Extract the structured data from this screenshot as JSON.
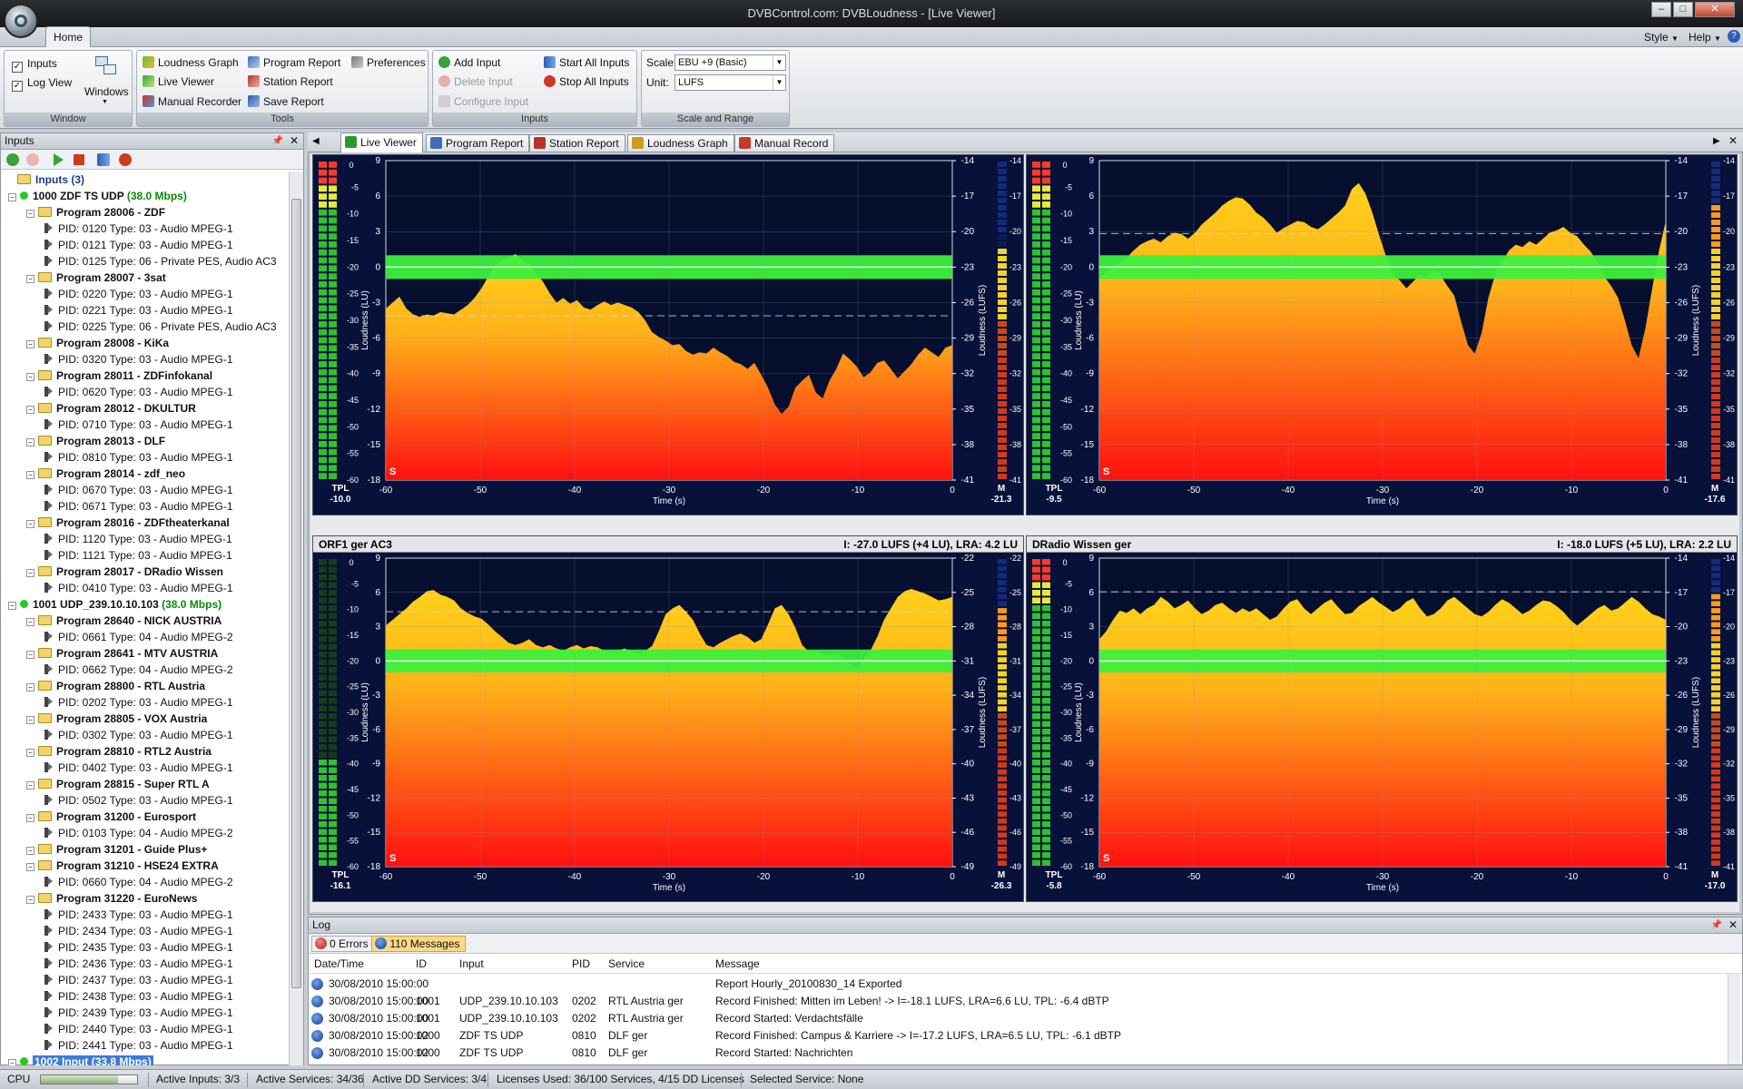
{
  "window": {
    "title": "DVBControl.com: DVBLoudness - [Live Viewer]",
    "buttons": [
      "–",
      "□",
      "✕"
    ]
  },
  "ribbon": {
    "tab": "Home",
    "right": [
      "Style",
      "Help"
    ],
    "window_group": {
      "label": "Window",
      "inputs": "Inputs",
      "log_view": "Log View",
      "windows": "Windows"
    },
    "tools_group": {
      "label": "Tools",
      "loudness_graph": "Loudness Graph",
      "live_viewer": "Live Viewer",
      "manual_recorder": "Manual Recorder",
      "program_report": "Program Report",
      "station_report": "Station Report",
      "save_report": "Save Report",
      "preferences": "Preferences"
    },
    "inputs_group": {
      "label": "Inputs",
      "add_input": "Add Input",
      "delete_input": "Delete Input",
      "configure_input": "Configure Input",
      "start_all": "Start All Inputs",
      "stop_all": "Stop All Inputs"
    },
    "scale_group": {
      "label": "Scale and Range",
      "scale_label": "Scale:",
      "scale_value": "EBU +9 (Basic)",
      "unit_label": "Unit:",
      "unit_value": "LUFS"
    }
  },
  "inputs_panel": {
    "title": "Inputs",
    "tree": [
      {
        "level": 0,
        "kind": "root",
        "text": "Inputs",
        "extra": " (3)"
      },
      {
        "level": 1,
        "kind": "input",
        "text": "1000 ZDF TS UDP",
        "extra": " (38.0 Mbps)"
      },
      {
        "level": 2,
        "kind": "program",
        "text": "Program 28006 - ZDF"
      },
      {
        "level": 3,
        "kind": "pid",
        "text": "PID: 0120  Type: 03 - Audio MPEG-1"
      },
      {
        "level": 3,
        "kind": "pid",
        "text": "PID: 0121  Type: 03 - Audio MPEG-1"
      },
      {
        "level": 3,
        "kind": "pid",
        "text": "PID: 0125  Type: 06 - Private PES, Audio AC3"
      },
      {
        "level": 2,
        "kind": "program",
        "text": "Program 28007 - 3sat"
      },
      {
        "level": 3,
        "kind": "pid",
        "text": "PID: 0220  Type: 03 - Audio MPEG-1"
      },
      {
        "level": 3,
        "kind": "pid",
        "text": "PID: 0221  Type: 03 - Audio MPEG-1"
      },
      {
        "level": 3,
        "kind": "pid",
        "text": "PID: 0225  Type: 06 - Private PES, Audio AC3"
      },
      {
        "level": 2,
        "kind": "program",
        "text": "Program 28008 - KiKa"
      },
      {
        "level": 3,
        "kind": "pid",
        "text": "PID: 0320  Type: 03 - Audio MPEG-1"
      },
      {
        "level": 2,
        "kind": "program",
        "text": "Program 28011 - ZDFinfokanal"
      },
      {
        "level": 3,
        "kind": "pid",
        "text": "PID: 0620  Type: 03 - Audio MPEG-1"
      },
      {
        "level": 2,
        "kind": "program",
        "text": "Program 28012 - DKULTUR"
      },
      {
        "level": 3,
        "kind": "pid",
        "text": "PID: 0710  Type: 03 - Audio MPEG-1"
      },
      {
        "level": 2,
        "kind": "program",
        "text": "Program 28013 - DLF"
      },
      {
        "level": 3,
        "kind": "pid",
        "text": "PID: 0810  Type: 03 - Audio MPEG-1"
      },
      {
        "level": 2,
        "kind": "program",
        "text": "Program 28014 - zdf_neo"
      },
      {
        "level": 3,
        "kind": "pid",
        "text": "PID: 0670  Type: 03 - Audio MPEG-1"
      },
      {
        "level": 3,
        "kind": "pid",
        "text": "PID: 0671  Type: 03 - Audio MPEG-1"
      },
      {
        "level": 2,
        "kind": "program",
        "text": "Program 28016 - ZDFtheaterkanal"
      },
      {
        "level": 3,
        "kind": "pid",
        "text": "PID: 1120  Type: 03 - Audio MPEG-1"
      },
      {
        "level": 3,
        "kind": "pid",
        "text": "PID: 1121  Type: 03 - Audio MPEG-1"
      },
      {
        "level": 2,
        "kind": "program",
        "text": "Program 28017 - DRadio Wissen"
      },
      {
        "level": 3,
        "kind": "pid",
        "text": "PID: 0410  Type: 03 - Audio MPEG-1"
      },
      {
        "level": 1,
        "kind": "input",
        "text": "1001 UDP_239.10.10.103",
        "extra": " (38.0 Mbps)"
      },
      {
        "level": 2,
        "kind": "program",
        "text": "Program 28640 - NICK AUSTRIA"
      },
      {
        "level": 3,
        "kind": "pid",
        "text": "PID: 0661  Type: 04 - Audio MPEG-2"
      },
      {
        "level": 2,
        "kind": "program",
        "text": "Program 28641 - MTV AUSTRIA"
      },
      {
        "level": 3,
        "kind": "pid",
        "text": "PID: 0662  Type: 04 - Audio MPEG-2"
      },
      {
        "level": 2,
        "kind": "program",
        "text": "Program 28800 - RTL Austria"
      },
      {
        "level": 3,
        "kind": "pid",
        "text": "PID: 0202  Type: 03 - Audio MPEG-1"
      },
      {
        "level": 2,
        "kind": "program",
        "text": "Program 28805 - VOX Austria"
      },
      {
        "level": 3,
        "kind": "pid",
        "text": "PID: 0302  Type: 03 - Audio MPEG-1"
      },
      {
        "level": 2,
        "kind": "program",
        "text": "Program 28810 - RTL2 Austria"
      },
      {
        "level": 3,
        "kind": "pid",
        "text": "PID: 0402  Type: 03 - Audio MPEG-1"
      },
      {
        "level": 2,
        "kind": "program",
        "text": "Program 28815 - Super RTL A"
      },
      {
        "level": 3,
        "kind": "pid",
        "text": "PID: 0502  Type: 03 - Audio MPEG-1"
      },
      {
        "level": 2,
        "kind": "program",
        "text": "Program 31200 - Eurosport"
      },
      {
        "level": 3,
        "kind": "pid",
        "text": "PID: 0103  Type: 04 - Audio MPEG-2"
      },
      {
        "level": 2,
        "kind": "program",
        "text": "Program 31201 - Guide Plus+"
      },
      {
        "level": 2,
        "kind": "program",
        "text": "Program 31210 - HSE24 EXTRA"
      },
      {
        "level": 3,
        "kind": "pid",
        "text": "PID: 0660  Type: 04 - Audio MPEG-2"
      },
      {
        "level": 2,
        "kind": "program",
        "text": "Program 31220 - EuroNews"
      },
      {
        "level": 3,
        "kind": "pid",
        "text": "PID: 2433  Type: 03 - Audio MPEG-1"
      },
      {
        "level": 3,
        "kind": "pid",
        "text": "PID: 2434  Type: 03 - Audio MPEG-1"
      },
      {
        "level": 3,
        "kind": "pid",
        "text": "PID: 2435  Type: 03 - Audio MPEG-1"
      },
      {
        "level": 3,
        "kind": "pid",
        "text": "PID: 2436  Type: 03 - Audio MPEG-1"
      },
      {
        "level": 3,
        "kind": "pid",
        "text": "PID: 2437  Type: 03 - Audio MPEG-1"
      },
      {
        "level": 3,
        "kind": "pid",
        "text": "PID: 2438  Type: 03 - Audio MPEG-1"
      },
      {
        "level": 3,
        "kind": "pid",
        "text": "PID: 2439  Type: 03 - Audio MPEG-1"
      },
      {
        "level": 3,
        "kind": "pid",
        "text": "PID: 2440  Type: 03 - Audio MPEG-1"
      },
      {
        "level": 3,
        "kind": "pid",
        "text": "PID: 2441  Type: 03 - Audio MPEG-1"
      },
      {
        "level": 1,
        "kind": "input_selected",
        "text": "1002 Input",
        "extra": " (33.8 Mbps)"
      }
    ]
  },
  "doc_tabs": [
    {
      "label": "Live Viewer",
      "active": true
    },
    {
      "label": "Program Report"
    },
    {
      "label": "Station Report"
    },
    {
      "label": "Loudness Graph"
    },
    {
      "label": "Manual Record"
    }
  ],
  "meters": [
    {
      "title": "",
      "stats": "",
      "tpl": "-10.0",
      "m": "-21.3",
      "right_ticks": [
        "-14",
        "-17",
        "-20",
        "-23",
        "-26",
        "-29",
        "-32",
        "-35",
        "-38",
        "-41"
      ],
      "history": [
        -3.5,
        -3,
        -2.5,
        -3.5,
        -4,
        -4.2,
        -4,
        -4.1,
        -3.8,
        -3.9,
        -4,
        -3.6,
        -3.2,
        -2.6,
        -1.8,
        -0.8,
        0.2,
        0.6,
        0.8,
        1.1,
        0.6,
        0.3,
        -0.5,
        -1.2,
        -2.2,
        -3,
        -2.6,
        -3.1,
        -2.8,
        -3.4,
        -3.6,
        -3.2,
        -2.9,
        -3.2,
        -3,
        -3.2,
        -3.4,
        -3.8,
        -4.5,
        -5.5,
        -5.9,
        -6.2,
        -6.6,
        -6.5,
        -7.1,
        -7.4,
        -7.2,
        -7.3,
        -6.8,
        -7.2,
        -7.5,
        -8,
        -8.2,
        -8.6,
        -8.1,
        -9.1,
        -10.2,
        -11.6,
        -12.4,
        -11.8,
        -10.2,
        -9.6,
        -9.1,
        -10.6,
        -11.1,
        -9.6,
        -8.6,
        -7.3,
        -7.8,
        -8.4,
        -9.3,
        -8.9,
        -8.1,
        -7.9,
        -8.6,
        -9.4,
        -8.8,
        -8.2,
        -7.4,
        -6.8,
        -7.2,
        -7.6,
        -6.8,
        -6.6
      ]
    },
    {
      "title": "",
      "stats": "",
      "tpl": "-9.5",
      "m": "-17.6",
      "right_ticks": [
        "-14",
        "-17",
        "-20",
        "-23",
        "-26",
        "-29",
        "-32",
        "-35",
        "-38",
        "-41"
      ],
      "history": [
        -0.8,
        -0.5,
        0.1,
        0.3,
        0.8,
        1.4,
        1.9,
        2.2,
        2.4,
        2.1,
        2.6,
        2.9,
        2.8,
        2.4,
        2.9,
        3.6,
        4.1,
        4.6,
        5.2,
        5.6,
        5.9,
        5.8,
        5.3,
        4.6,
        4.2,
        3.6,
        2.9,
        3.3,
        3.6,
        3.9,
        3.8,
        3.4,
        3.2,
        3.6,
        4.1,
        4.6,
        5.2,
        6.6,
        7.1,
        6.2,
        4.6,
        2.7,
        0.9,
        -0.6,
        -1.1,
        -1.8,
        -1.2,
        -0.6,
        -0.8,
        -0.2,
        -0.7,
        -1.6,
        -2.4,
        -4.6,
        -6.6,
        -7.3,
        -5.6,
        -2.6,
        -0.6,
        0.4,
        1.4,
        1.9,
        1.7,
        2.2,
        1.9,
        2.4,
        2.9,
        3.1,
        3.4,
        2.9,
        2.6,
        1.9,
        1.3,
        0.4,
        -0.8,
        -1.6,
        -2.6,
        -4.5,
        -6.6,
        -7.7,
        -5.2,
        -1.8,
        1.4,
        3.9
      ]
    },
    {
      "title": "ORF1 ger AC3",
      "stats": "I: -27.0 LUFS (+4 LU),  LRA: 4.2 LU",
      "tpl": "-16.1",
      "m": "-26.3",
      "right_ticks": [
        "-22",
        "-25",
        "-28",
        "-31",
        "-34",
        "-37",
        "-40",
        "-43",
        "-46",
        "-49"
      ],
      "history": [
        3.1,
        3.6,
        4.1,
        4.6,
        5.2,
        5.6,
        6.1,
        6.2,
        5.8,
        5.6,
        5.3,
        4.6,
        4.2,
        3.9,
        3.7,
        3.2,
        2.6,
        2.1,
        1.6,
        1.4,
        1.6,
        1.9,
        1.4,
        1.2,
        1.4,
        1.1,
        0.9,
        1.2,
        1.4,
        1.1,
        1.3,
        1.2,
        0.9,
        0.7,
        0.9,
        1.1,
        0.8,
        0.6,
        0.9,
        1.3,
        2.6,
        4.1,
        4.6,
        4.9,
        4.3,
        3.6,
        2.4,
        1.4,
        1.2,
        1.6,
        1.9,
        2.2,
        2.4,
        2.1,
        1.6,
        1.9,
        3.2,
        4.6,
        4.9,
        4.1,
        2.9,
        1.4,
        0.8,
        0.9,
        0.6,
        0.4,
        0.6,
        0.2,
        -0.2,
        -0.6,
        0.1,
        0.9,
        2.1,
        3.6,
        4.6,
        5.6,
        6.1,
        6.3,
        6.1,
        5.9,
        5.6,
        5.3,
        5.4,
        5.6
      ]
    },
    {
      "title": "DRadio Wissen ger",
      "stats": "I: -18.0 LUFS (+5 LU),  LRA: 2.2 LU",
      "tpl": "-5.8",
      "m": "-17.0",
      "right_ticks": [
        "-14",
        "-17",
        "-20",
        "-23",
        "-26",
        "-29",
        "-32",
        "-35",
        "-38",
        "-41"
      ],
      "history": [
        1.9,
        2.6,
        3.6,
        4.4,
        4.2,
        4.6,
        4.1,
        4.6,
        4.9,
        5.6,
        5.2,
        4.6,
        4.9,
        5.3,
        4.6,
        4.1,
        4.4,
        4.9,
        5.1,
        4.6,
        4.2,
        4.6,
        4.3,
        4.6,
        4.1,
        3.6,
        3.9,
        4.6,
        5.2,
        5.4,
        4.6,
        4.1,
        4.6,
        5.1,
        5.4,
        4.7,
        4.1,
        4.2,
        4.8,
        5.2,
        5.6,
        5.1,
        4.7,
        4.3,
        4.6,
        5.2,
        5.5,
        4.6,
        3.9,
        4.1,
        4.6,
        5.3,
        5.6,
        5.1,
        4.6,
        4.1,
        3.9,
        4.3,
        4.9,
        5.4,
        5.1,
        4.6,
        4.1,
        4.4,
        4.9,
        5.3,
        5.2,
        4.8,
        4.3,
        3.6,
        3.1,
        3.6,
        4.1,
        4.6,
        4.9,
        4.4,
        4.6,
        5.1,
        5.6,
        5.2,
        4.6,
        4.1,
        3.9,
        3.6
      ]
    }
  ],
  "chart_axes": {
    "x_ticks": [
      "-60",
      "-50",
      "-40",
      "-30",
      "-20",
      "-10",
      "0"
    ],
    "xlabel": "Time (s)",
    "y_ticks": [
      "9",
      "6",
      "3",
      "0",
      "-3",
      "-6",
      "-9",
      "-12",
      "-15",
      "-18"
    ],
    "ylabel_left": "Loudness (LU)",
    "ylabel_right": "Loudness (LUFS)",
    "ylim": [
      -18,
      9
    ],
    "xlim": [
      -60,
      0
    ],
    "target_band": [
      -1,
      1
    ],
    "s_label": "S",
    "tpl_label": "TPL",
    "m_label": "M",
    "meter_ticks": [
      "0",
      "-5",
      "-10",
      "-15",
      "-20",
      "-25",
      "-30",
      "-35",
      "-40",
      "-45",
      "-50",
      "-55",
      "-60"
    ]
  },
  "log": {
    "title": "Log",
    "errors_tab": "0 Errors",
    "messages_tab": "110 Messages",
    "columns": [
      "Date/Time",
      "ID",
      "Input",
      "PID",
      "Service",
      "Message"
    ],
    "rows": [
      [
        "30/08/2010 15:00:00",
        "",
        "",
        "",
        "",
        "Report Hourly_20100830_14 Exported"
      ],
      [
        "30/08/2010 15:00:00",
        "1001",
        "UDP_239.10.10.103",
        "0202",
        "RTL Austria ger",
        "Record Finished: Mitten im Leben! -> I=-18.1 LUFS, LRA=6.6 LU, TPL: -6.4 dBTP"
      ],
      [
        "30/08/2010 15:00:00",
        "1001",
        "UDP_239.10.10.103",
        "0202",
        "RTL Austria ger",
        "Record Started: Verdachtsfälle"
      ],
      [
        "30/08/2010 15:00:02",
        "1000",
        "ZDF TS UDP",
        "0810",
        "DLF ger",
        "Record Finished: Campus & Karriere -> I=-17.2 LUFS, LRA=6.5 LU, TPL: -6.1 dBTP"
      ],
      [
        "30/08/2010 15:00:02",
        "1000",
        "ZDF TS UDP",
        "0810",
        "DLF ger",
        "Record Started: Nachrichten"
      ]
    ]
  },
  "status": {
    "cpu_label": "CPU",
    "cpu_level": 0.8,
    "active_inputs": "Active Inputs: 3/3",
    "active_services": "Active Services: 34/36",
    "active_dd": "Active DD Services: 3/4",
    "licenses": "Licenses Used: 36/100 Services, 4/15 DD Licenses",
    "selected": "Selected Service: None"
  },
  "colors": {
    "accent": "#2a5fb8",
    "meter_bg": "#07113a",
    "target_band": "#3cf03c",
    "input_rate": "#0a8a0a"
  }
}
